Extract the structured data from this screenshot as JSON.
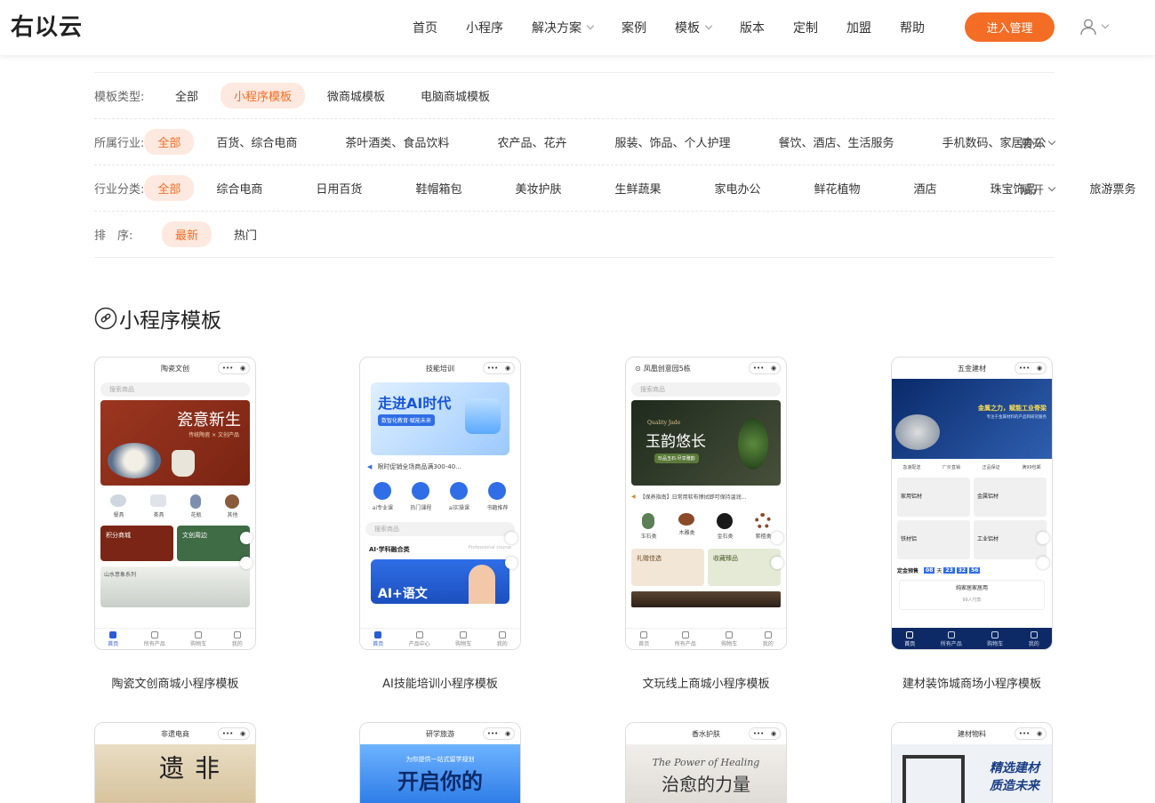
{
  "header": {
    "logo": "右以云",
    "nav": [
      {
        "label": "首页",
        "dropdown": false
      },
      {
        "label": "小程序",
        "dropdown": false
      },
      {
        "label": "解决方案",
        "dropdown": true
      },
      {
        "label": "案例",
        "dropdown": false
      },
      {
        "label": "模板",
        "dropdown": true
      },
      {
        "label": "版本",
        "dropdown": false
      },
      {
        "label": "定制",
        "dropdown": false
      },
      {
        "label": "加盟",
        "dropdown": false
      },
      {
        "label": "帮助",
        "dropdown": false
      }
    ],
    "cta": "进入管理",
    "accent": "#f36d25"
  },
  "filters": {
    "type": {
      "label": "模板类型:",
      "options": [
        "全部",
        "小程序模板",
        "微商城模板",
        "电脑商城模板"
      ],
      "active": 1
    },
    "industry": {
      "label": "所属行业:",
      "options": [
        "全部",
        "百货、综合电商",
        "茶叶酒类、食品饮料",
        "农产品、花卉",
        "服装、饰品、个人护理",
        "餐饮、酒店、生活服务",
        "手机数码、家居办公"
      ],
      "active": 0,
      "expand": "展开"
    },
    "category": {
      "label": "行业分类:",
      "options": [
        "全部",
        "综合电商",
        "日用百货",
        "鞋帽箱包",
        "美妆护肤",
        "生鲜蔬果",
        "家电办公",
        "鲜花植物",
        "酒店",
        "珠宝饰品",
        "旅游票务"
      ],
      "active": 0,
      "expand": "展开"
    },
    "sort": {
      "label": "排　序:",
      "options": [
        "最新",
        "热门"
      ],
      "active": 0
    }
  },
  "section": {
    "title": "小程序模板"
  },
  "cards": [
    {
      "title": "陶瓷文创商城小程序模板",
      "phone_title": "陶瓷文创",
      "search": "搜索商品",
      "banner": "瓷意新生",
      "banner_sub": "传统陶瓷 × 文创产品",
      "icons": [
        "餐具",
        "茶具",
        "花瓶",
        "其他"
      ],
      "promo": [
        "积分商城",
        "文创周边"
      ],
      "strip": "山水意象系列",
      "tabs": [
        "首页",
        "所有产品",
        "购物车",
        "我的"
      ],
      "theme": "#8b2a16"
    },
    {
      "title": "AI技能培训小程序模板",
      "phone_title": "技能培训",
      "banner": "走进AI时代",
      "banner_sub": "数智化教育·赋能未来",
      "notice": "限时促销全场商品满300-40...",
      "icons": [
        "ai专业课",
        "热门课程",
        "ai实操课",
        "书籍推荐"
      ],
      "search": "搜索商品",
      "section": "AI·学科融合类",
      "section_en": "Professional course",
      "hero": "AI+语文",
      "tabs": [
        "首页",
        "产品中心",
        "购物车",
        "我的"
      ],
      "theme": "#2f6ee6"
    },
    {
      "title": "文玩线上商城小程序模板",
      "phone_title": "凤凰创意园5栋",
      "search": "搜索商品",
      "banner": "玉韵悠长",
      "banner_en": "Quality Jade",
      "banner_sub": "珍品玉石·尽享雅韵",
      "notice": "【保养指南】日常用软布擦拭即可保持温润...",
      "icons": [
        "玉石类",
        "木雕类",
        "金石类",
        "紫檀类"
      ],
      "promo": [
        "礼赠佳选",
        "收藏臻品"
      ],
      "tabs": [
        "首页",
        "所有产品",
        "购物车",
        "我的"
      ],
      "theme": "#3d4a2c"
    },
    {
      "title": "建材装饰城商场小程序模板",
      "phone_title": "五金建材",
      "banner": "金属之力，赋能工业脊梁",
      "banner_sub": "专注于金属材料的产品和研究服务",
      "badges": [
        "急速配送",
        "厂价直销",
        "正品保证",
        "满99包邮"
      ],
      "items": [
        "家用铝材",
        "金属铝材",
        "铁材铝",
        "工业铝材"
      ],
      "countdown_label": "定金预售",
      "countdown": [
        "08",
        "天",
        "23",
        "32",
        "56"
      ],
      "subsection": "纯家居家居用",
      "sub_price": "99人付款",
      "tabs": [
        "首页",
        "所有产品",
        "购物车",
        "我的"
      ],
      "theme": "#0e2a66"
    },
    {
      "title": "",
      "phone_title": "非遗电商",
      "banner": "非遗",
      "theme": "#d9c6a5"
    },
    {
      "title": "",
      "phone_title": "研学旅游",
      "banner": "开启你的",
      "banner_sub": "为你提供一站式留学规划",
      "theme": "#3b8df0"
    },
    {
      "title": "",
      "phone_title": "香水护肤",
      "banner": "治愈的力量",
      "banner_en": "The Power of Healing",
      "theme": "#e9e6e2"
    },
    {
      "title": "",
      "phone_title": "建材物料",
      "banner": "精选建材",
      "banner_sub": "质造未来",
      "theme": "#eef1f5"
    }
  ]
}
